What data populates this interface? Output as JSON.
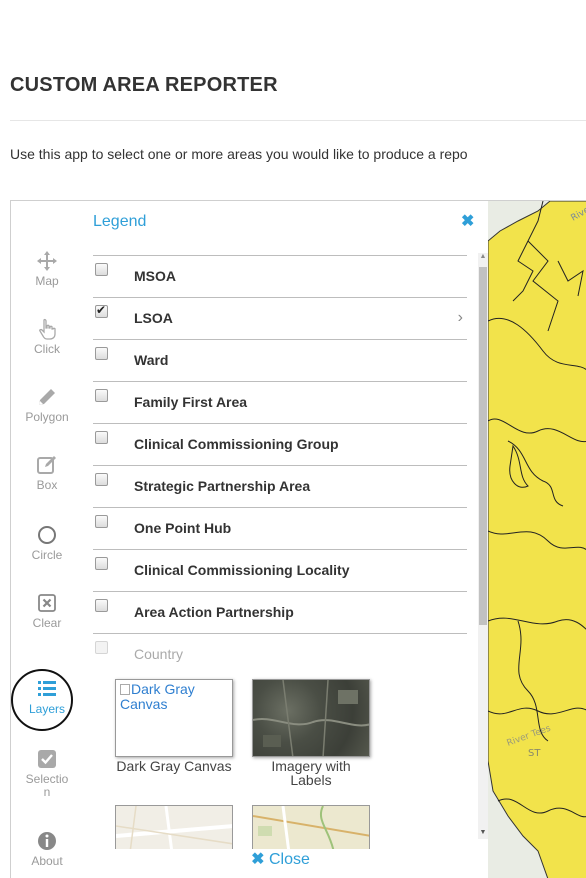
{
  "page": {
    "title": "CUSTOM AREA REPORTER",
    "intro": "Use this app to select one or more areas you would like to produce a repo"
  },
  "toolbar": {
    "tools": [
      {
        "label": "Map",
        "icon": "move-icon",
        "active": false
      },
      {
        "label": "Click",
        "icon": "pointer-hand-icon",
        "active": false
      },
      {
        "label": "Polygon",
        "icon": "pencil-icon",
        "active": false
      },
      {
        "label": "Box",
        "icon": "edit-box-icon",
        "active": false
      },
      {
        "label": "Circle",
        "icon": "circle-icon",
        "active": false
      },
      {
        "label": "Clear",
        "icon": "clear-x-icon",
        "active": false
      },
      {
        "label": "Layers",
        "icon": "list-icon",
        "active": true
      },
      {
        "label": "Selection",
        "icon": "checkbox-icon",
        "active": false
      },
      {
        "label": "About",
        "icon": "info-icon",
        "active": false
      }
    ]
  },
  "legend": {
    "title": "Legend",
    "close_icon": "close-x-icon",
    "layers": [
      {
        "name": "MSOA",
        "checked": false,
        "disabled": false
      },
      {
        "name": "LSOA",
        "checked": true,
        "disabled": false,
        "expandable": true
      },
      {
        "name": "Ward",
        "checked": false,
        "disabled": false
      },
      {
        "name": "Family First Area",
        "checked": false,
        "disabled": false
      },
      {
        "name": "Clinical Commissioning Group",
        "checked": false,
        "disabled": false
      },
      {
        "name": "Strategic Partnership Area",
        "checked": false,
        "disabled": false
      },
      {
        "name": "One Point Hub",
        "checked": false,
        "disabled": false
      },
      {
        "name": "Clinical Commissioning Locality",
        "checked": false,
        "disabled": false
      },
      {
        "name": "Area Action Partnership",
        "checked": false,
        "disabled": false
      },
      {
        "name": "Country",
        "checked": false,
        "disabled": true
      }
    ],
    "basemaps": [
      {
        "alt": "Dark Gray Canvas",
        "label": "Dark Gray Canvas"
      },
      {
        "alt": "",
        "label": "Imagery with Labels"
      }
    ],
    "close_label": "Close"
  },
  "map": {
    "fill_color": "#f2e34b",
    "labels": [
      "River Dee",
      "River Tees",
      "ST"
    ]
  },
  "colors": {
    "accent": "#2f9fd8",
    "map_fill": "#f2e34b"
  }
}
